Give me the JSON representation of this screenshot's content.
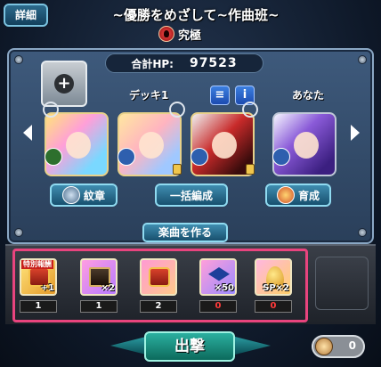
{
  "header": {
    "detail_label": "詳細",
    "stage_title": "~優勝をめざして~作曲班~",
    "difficulty": "究極"
  },
  "deck": {
    "hp_label": "合計HP:",
    "hp_value": "97523",
    "deck_label": "デッキ1",
    "you_label": "あなた",
    "list_icon": "list-icon",
    "info_label": "i"
  },
  "buttons": {
    "emblem": "紋章",
    "bulk_edit": "一括編成",
    "train": "育成",
    "make_music": "楽曲を作る",
    "sortie": "出撃",
    "toggle_value": "0"
  },
  "rewards": [
    {
      "tag": "特別報酬",
      "mult": "+1",
      "count": "1",
      "icon": "chest-icon",
      "zero": false
    },
    {
      "tag": "",
      "mult": "×2",
      "count": "1",
      "icon": "card-icon",
      "zero": false
    },
    {
      "tag": "",
      "mult": "",
      "count": "2",
      "icon": "chest-icon",
      "zero": false
    },
    {
      "tag": "",
      "mult": "×50",
      "count": "0",
      "icon": "graduation-cap-icon",
      "zero": true
    },
    {
      "tag": "",
      "mult": "SP×2",
      "count": "0",
      "icon": "egg-icon",
      "zero": true
    }
  ],
  "colors": {
    "accent_frame": "#e8447e",
    "button_teal": "#2bb0a0",
    "button_blue": "#3f8db0",
    "zero_count": "#ff3a3a"
  }
}
